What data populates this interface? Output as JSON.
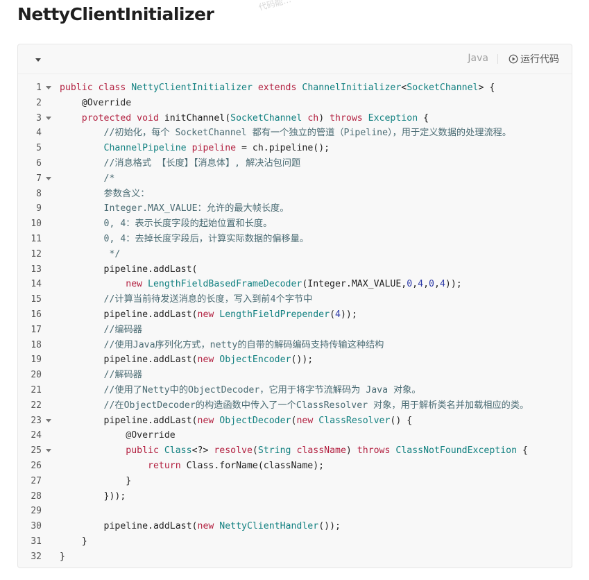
{
  "title": "NettyClientInitializer",
  "watermark": "代码能…",
  "toolbar": {
    "language": "Java",
    "run_label": "运行代码"
  },
  "code": {
    "lines": [
      {
        "n": "1",
        "fold": true,
        "tokens": [
          [
            "kw",
            "public class "
          ],
          [
            "ty",
            "NettyClientInitializer "
          ],
          [
            "kw",
            "extends "
          ],
          [
            "ty",
            "ChannelInitializer"
          ],
          [
            "pl",
            "<"
          ],
          [
            "ty",
            "SocketChannel"
          ],
          [
            "pl",
            "> {"
          ]
        ]
      },
      {
        "n": "2",
        "fold": false,
        "tokens": [
          [
            "pl",
            "    "
          ],
          [
            "an",
            "@Override"
          ]
        ]
      },
      {
        "n": "3",
        "fold": true,
        "tokens": [
          [
            "pl",
            "    "
          ],
          [
            "kw",
            "protected void "
          ],
          [
            "fn",
            "initChannel"
          ],
          [
            "pl",
            "("
          ],
          [
            "ty",
            "SocketChannel "
          ],
          [
            "kw",
            "ch"
          ],
          [
            "pl",
            ") "
          ],
          [
            "kw",
            "throws "
          ],
          [
            "ty",
            "Exception "
          ],
          [
            "pl",
            "{"
          ]
        ]
      },
      {
        "n": "4",
        "fold": false,
        "tokens": [
          [
            "pl",
            "        "
          ],
          [
            "cm",
            "//初始化，每个 SocketChannel 都有一个独立的管道（Pipeline），用于定义数据的处理流程。"
          ]
        ]
      },
      {
        "n": "5",
        "fold": false,
        "tokens": [
          [
            "pl",
            "        "
          ],
          [
            "ty",
            "ChannelPipeline "
          ],
          [
            "kw",
            "pipeline "
          ],
          [
            "pl",
            "= ch.pipeline();"
          ]
        ]
      },
      {
        "n": "6",
        "fold": false,
        "tokens": [
          [
            "pl",
            "        "
          ],
          [
            "cm",
            "//消息格式 【长度】【消息体】, 解决沾包问题"
          ]
        ]
      },
      {
        "n": "7",
        "fold": true,
        "tokens": [
          [
            "pl",
            "        "
          ],
          [
            "cm",
            "/*"
          ]
        ]
      },
      {
        "n": "8",
        "fold": false,
        "tokens": [
          [
            "pl",
            "        "
          ],
          [
            "cm",
            "参数含义："
          ]
        ]
      },
      {
        "n": "9",
        "fold": false,
        "tokens": [
          [
            "pl",
            "        "
          ],
          [
            "cm",
            "Integer.MAX_VALUE：允许的最大帧长度。"
          ]
        ]
      },
      {
        "n": "10",
        "fold": false,
        "tokens": [
          [
            "pl",
            "        "
          ],
          [
            "cm",
            "0, 4：表示长度字段的起始位置和长度。"
          ]
        ]
      },
      {
        "n": "11",
        "fold": false,
        "tokens": [
          [
            "pl",
            "        "
          ],
          [
            "cm",
            "0, 4：去掉长度字段后，计算实际数据的偏移量。"
          ]
        ]
      },
      {
        "n": "12",
        "fold": false,
        "tokens": [
          [
            "pl",
            "        "
          ],
          [
            "cm",
            " */"
          ]
        ]
      },
      {
        "n": "13",
        "fold": false,
        "tokens": [
          [
            "pl",
            "        pipeline.addLast("
          ]
        ]
      },
      {
        "n": "14",
        "fold": false,
        "tokens": [
          [
            "pl",
            "            "
          ],
          [
            "kw",
            "new "
          ],
          [
            "ty",
            "LengthFieldBasedFrameDecoder"
          ],
          [
            "pl",
            "(Integer.MAX_VALUE,"
          ],
          [
            "nm",
            "0"
          ],
          [
            "pl",
            ","
          ],
          [
            "nm",
            "4"
          ],
          [
            "pl",
            ","
          ],
          [
            "nm",
            "0"
          ],
          [
            "pl",
            ","
          ],
          [
            "nm",
            "4"
          ],
          [
            "pl",
            "));"
          ]
        ]
      },
      {
        "n": "15",
        "fold": false,
        "tokens": [
          [
            "pl",
            "        "
          ],
          [
            "cm",
            "//计算当前待发送消息的长度，写入到前4个字节中"
          ]
        ]
      },
      {
        "n": "16",
        "fold": false,
        "tokens": [
          [
            "pl",
            "        pipeline.addLast("
          ],
          [
            "kw",
            "new "
          ],
          [
            "ty",
            "LengthFieldPrepender"
          ],
          [
            "pl",
            "("
          ],
          [
            "nm",
            "4"
          ],
          [
            "pl",
            "));"
          ]
        ]
      },
      {
        "n": "17",
        "fold": false,
        "tokens": [
          [
            "pl",
            "        "
          ],
          [
            "cm",
            "//编码器"
          ]
        ]
      },
      {
        "n": "18",
        "fold": false,
        "tokens": [
          [
            "pl",
            "        "
          ],
          [
            "cm",
            "//使用Java序列化方式，netty的自带的解码编码支持传输这种结构"
          ]
        ]
      },
      {
        "n": "19",
        "fold": false,
        "tokens": [
          [
            "pl",
            "        pipeline.addLast("
          ],
          [
            "kw",
            "new "
          ],
          [
            "ty",
            "ObjectEncoder"
          ],
          [
            "pl",
            "());"
          ]
        ]
      },
      {
        "n": "20",
        "fold": false,
        "tokens": [
          [
            "pl",
            "        "
          ],
          [
            "cm",
            "//解码器"
          ]
        ]
      },
      {
        "n": "21",
        "fold": false,
        "tokens": [
          [
            "pl",
            "        "
          ],
          [
            "cm",
            "//使用了Netty中的ObjectDecoder，它用于将字节流解码为 Java 对象。"
          ]
        ]
      },
      {
        "n": "22",
        "fold": false,
        "tokens": [
          [
            "pl",
            "        "
          ],
          [
            "cm",
            "//在ObjectDecoder的构造函数中传入了一个ClassResolver 对象，用于解析类名并加载相应的类。"
          ]
        ]
      },
      {
        "n": "23",
        "fold": true,
        "tokens": [
          [
            "pl",
            "        pipeline.addLast("
          ],
          [
            "kw",
            "new "
          ],
          [
            "ty",
            "ObjectDecoder"
          ],
          [
            "pl",
            "("
          ],
          [
            "kw",
            "new "
          ],
          [
            "ty",
            "ClassResolver"
          ],
          [
            "pl",
            "() {"
          ]
        ]
      },
      {
        "n": "24",
        "fold": false,
        "tokens": [
          [
            "pl",
            "            "
          ],
          [
            "an",
            "@Override"
          ]
        ]
      },
      {
        "n": "25",
        "fold": true,
        "tokens": [
          [
            "pl",
            "            "
          ],
          [
            "kw",
            "public "
          ],
          [
            "ty",
            "Class"
          ],
          [
            "pl",
            "<?> "
          ],
          [
            "kw",
            "resolve"
          ],
          [
            "pl",
            "("
          ],
          [
            "ty",
            "String "
          ],
          [
            "kw",
            "className"
          ],
          [
            "pl",
            ") "
          ],
          [
            "kw",
            "throws "
          ],
          [
            "ty",
            "ClassNotFoundException "
          ],
          [
            "pl",
            "{"
          ]
        ]
      },
      {
        "n": "26",
        "fold": false,
        "tokens": [
          [
            "pl",
            "                "
          ],
          [
            "kw",
            "return "
          ],
          [
            "pl",
            "Class.forName(className);"
          ]
        ]
      },
      {
        "n": "27",
        "fold": false,
        "tokens": [
          [
            "pl",
            "            }"
          ]
        ]
      },
      {
        "n": "28",
        "fold": false,
        "tokens": [
          [
            "pl",
            "        }));"
          ]
        ]
      },
      {
        "n": "29",
        "fold": false,
        "tokens": [
          [
            "pl",
            ""
          ]
        ]
      },
      {
        "n": "30",
        "fold": false,
        "tokens": [
          [
            "pl",
            "        pipeline.addLast("
          ],
          [
            "kw",
            "new "
          ],
          [
            "ty",
            "NettyClientHandler"
          ],
          [
            "pl",
            "());"
          ]
        ]
      },
      {
        "n": "31",
        "fold": false,
        "tokens": [
          [
            "pl",
            "    }"
          ]
        ]
      },
      {
        "n": "32",
        "fold": false,
        "tokens": [
          [
            "pl",
            "}"
          ]
        ]
      }
    ]
  }
}
